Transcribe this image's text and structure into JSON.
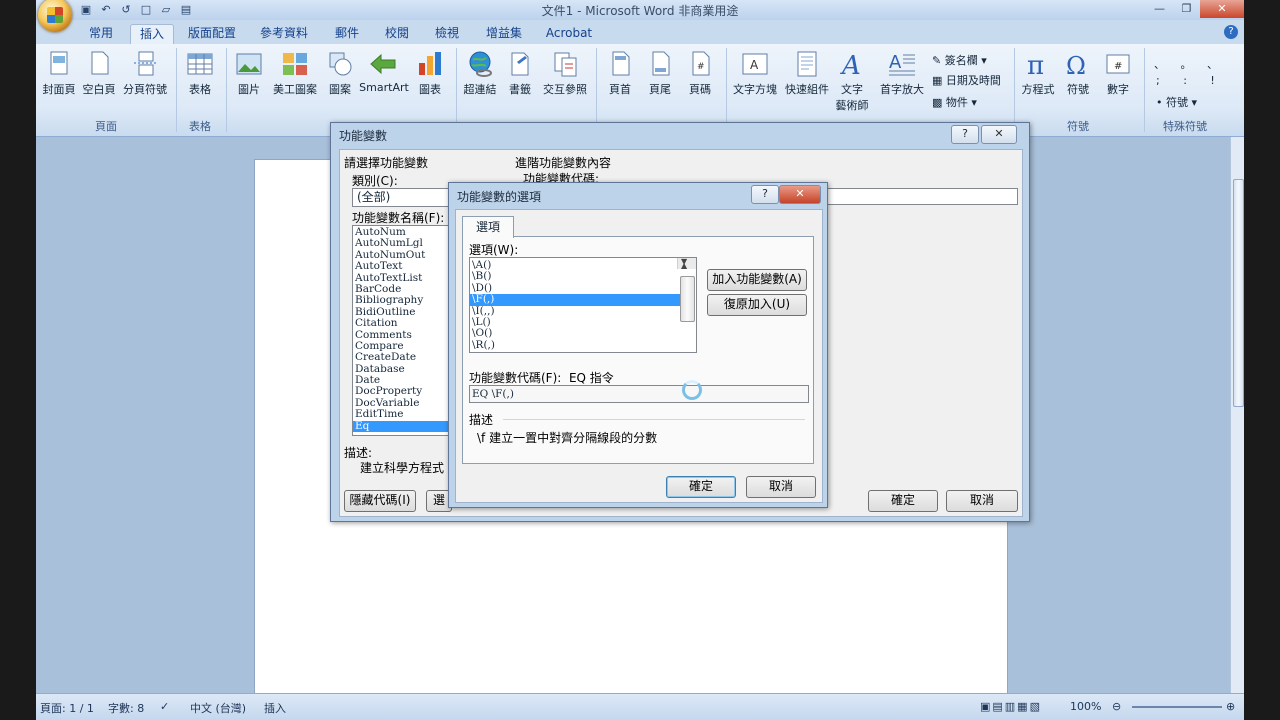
{
  "window": {
    "title": "文件1 - Microsoft Word 非商業用途"
  },
  "ribbon_tabs": [
    "常用",
    "插入",
    "版面配置",
    "參考資料",
    "郵件",
    "校閱",
    "檢視",
    "增益集",
    "Acrobat"
  ],
  "ribbon": {
    "page_group": {
      "label": "頁面",
      "buttons": [
        "封面頁",
        "空白頁",
        "分頁符號"
      ]
    },
    "table_group": {
      "label": "表格",
      "buttons": [
        "表格"
      ]
    },
    "illust_group": {
      "buttons": [
        "圖片",
        "美工圖案",
        "圖案",
        "SmartArt",
        "圖表"
      ]
    },
    "link_group": {
      "buttons": [
        "超連結",
        "書籤",
        "交互參照"
      ]
    },
    "hf_group": {
      "buttons": [
        "頁首",
        "頁尾",
        "頁碼"
      ]
    },
    "text_group": {
      "buttons": [
        "文字方塊",
        "快速組件",
        "文字\n藝術師",
        "首字放大"
      ],
      "small": [
        "簽名欄",
        "日期及時間",
        "物件"
      ]
    },
    "symbol_group": {
      "label": "符號",
      "buttons": [
        "方程式",
        "符號",
        "數字"
      ]
    },
    "special_group": {
      "label": "特殊符號",
      "small": [
        "符號"
      ]
    }
  },
  "field_dialog": {
    "title": "功能變數",
    "choose_label": "請選擇功能變數",
    "category_label": "類別(C):",
    "category_value": "(全部)",
    "field_names_label": "功能變數名稱(F):",
    "field_names": [
      "AutoNum",
      "AutoNumLgl",
      "AutoNumOut",
      "AutoText",
      "AutoTextList",
      "BarCode",
      "Bibliography",
      "BidiOutline",
      "Citation",
      "Comments",
      "Compare",
      "CreateDate",
      "Database",
      "Date",
      "DocProperty",
      "DocVariable",
      "EditTime",
      "Eq"
    ],
    "selected_field": "Eq",
    "advanced_label": "進階功能變數內容",
    "field_code_label": "功能變數代碼:",
    "desc_label": "描述:",
    "desc_text": "建立科學方程式",
    "hide_codes_button": "隱藏代碼(I)",
    "options_button_partial": "選",
    "ok": "確定",
    "cancel": "取消"
  },
  "options_dialog": {
    "title": "功能變數的選項",
    "tab": "選項",
    "switches_label": "選項(W):",
    "switches": [
      "\\A()",
      "\\B()",
      "\\D()",
      "\\F(,)",
      "\\I(,,)",
      "\\L()",
      "\\O()",
      "\\R(,)"
    ],
    "selected_switch": "\\F(,)",
    "add_button": "加入功能變數(A)",
    "undo_button": "復原加入(U)",
    "code_label": "功能變數代碼(F):",
    "code_type": "EQ 指令",
    "code_value": "EQ \\F(,)",
    "desc_label": "描述",
    "desc_text": "\\f 建立一置中對齊分隔線段的分數",
    "ok": "確定",
    "cancel": "取消"
  },
  "statusbar": {
    "page": "頁面: 1 / 1",
    "words": "字數: 8",
    "lang": "中文 (台灣)",
    "mode": "插入",
    "zoom": "100%"
  }
}
